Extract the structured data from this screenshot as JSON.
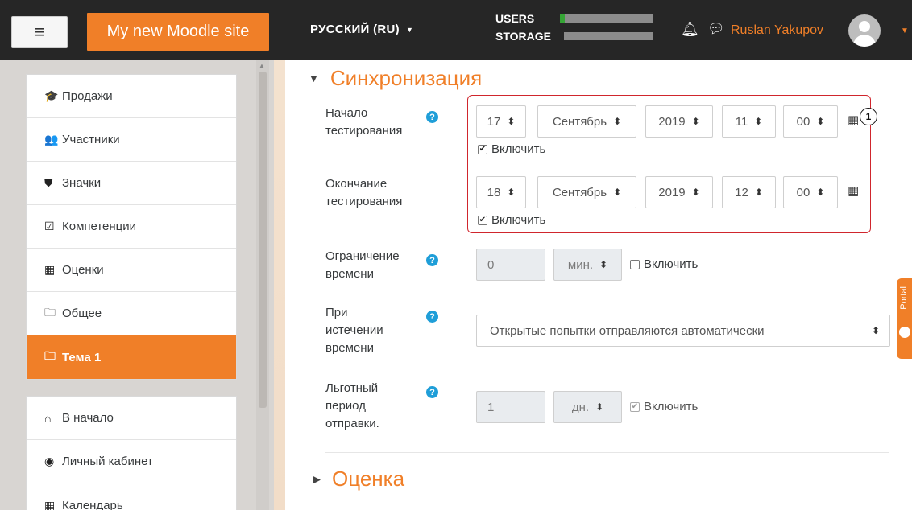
{
  "navbar": {
    "menu_icon": "hamburger-icon",
    "site_name": "My new Moodle site",
    "language": "РУССКИЙ (RU)",
    "users_label": "USERS",
    "storage_label": "STORAGE",
    "users_usage": 0.05,
    "user_name": "Ruslan Yakupov",
    "accent_color": "#f07f28"
  },
  "sidebar": {
    "group1": [
      {
        "icon": "graduation-cap-icon",
        "glyph": "🎓",
        "label": "Продажи"
      },
      {
        "icon": "users-icon",
        "glyph": "👥",
        "label": "Участники"
      },
      {
        "icon": "shield-icon",
        "glyph": "⛊",
        "label": "Значки"
      },
      {
        "icon": "check-square-icon",
        "glyph": "☑",
        "label": "Компетенции"
      },
      {
        "icon": "table-icon",
        "glyph": "▦",
        "label": "Оценки"
      },
      {
        "icon": "folder-icon",
        "glyph": "🗀",
        "label": "Общее"
      },
      {
        "icon": "folder-icon",
        "glyph": "🗀",
        "label": "Тема 1",
        "active": true
      }
    ],
    "group2": [
      {
        "icon": "home-icon",
        "glyph": "⌂",
        "label": "В начало"
      },
      {
        "icon": "dashboard-icon",
        "glyph": "◉",
        "label": "Личный кабинет"
      },
      {
        "icon": "calendar-icon",
        "glyph": "▦",
        "label": "Календарь"
      }
    ]
  },
  "main": {
    "section_timing": "Синхронизация",
    "section_grade": "Оценка",
    "open_label": "Начало\nтестирования",
    "open": {
      "day": "17",
      "month": "Сентябрь",
      "year": "2019",
      "hour": "11",
      "minute": "00",
      "enable": "Включить",
      "enabled": true
    },
    "close_label": "Окончание\nтестирования",
    "close": {
      "day": "18",
      "month": "Сентябрь",
      "year": "2019",
      "hour": "12",
      "minute": "00",
      "enable": "Включить",
      "enabled": true
    },
    "limit_label": "Ограничение\nвремени",
    "limit": {
      "value": "0",
      "unit": "мин.",
      "enable": "Включить",
      "enabled": false
    },
    "expire_label": "При\nистечении\nвремени",
    "expire_value": "Открытые попытки отправляются автоматически",
    "grace_label": "Льготный\nпериод\nотправки.",
    "grace": {
      "value": "1",
      "unit": "дн.",
      "enable": "Включить",
      "enabled": true
    },
    "callout_number": "1",
    "portal_tab": "Portal"
  }
}
